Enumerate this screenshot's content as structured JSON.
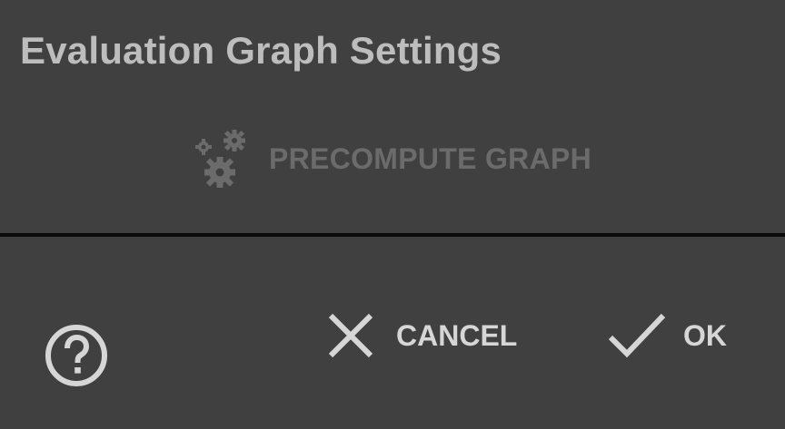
{
  "dialog": {
    "title": "Evaluation Graph Settings",
    "precompute": {
      "label": "PRECOMPUTE GRAPH",
      "icon": "gears-icon",
      "enabled": false
    },
    "buttons": {
      "help_icon": "help-circle-icon",
      "cancel_label": "CANCEL",
      "cancel_icon": "close-icon",
      "ok_label": "OK",
      "ok_icon": "checkmark-icon"
    }
  },
  "colors": {
    "background": "#404040",
    "title_text": "#bdbdbd",
    "disabled_text": "#6b6b6b",
    "button_text": "#d6d6d6",
    "divider": "#0a0a0a"
  }
}
